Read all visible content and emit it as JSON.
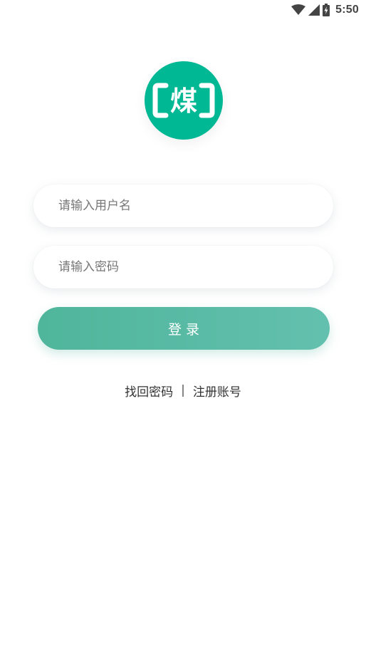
{
  "status_bar": {
    "time": "5:50",
    "icons": [
      "wifi-icon",
      "cell-signal-icon",
      "battery-charging-icon"
    ]
  },
  "logo": {
    "character": "煤",
    "background_color": "#00b894"
  },
  "form": {
    "username_placeholder": "请输入用户名",
    "password_placeholder": "请输入密码",
    "login_label": "登录"
  },
  "links": {
    "forgot_password": "找回密码",
    "separator": "|",
    "register": "注册账号"
  },
  "colors": {
    "accent": "#4fb59b",
    "accent_light": "#63c0ae",
    "text": "#333333"
  }
}
